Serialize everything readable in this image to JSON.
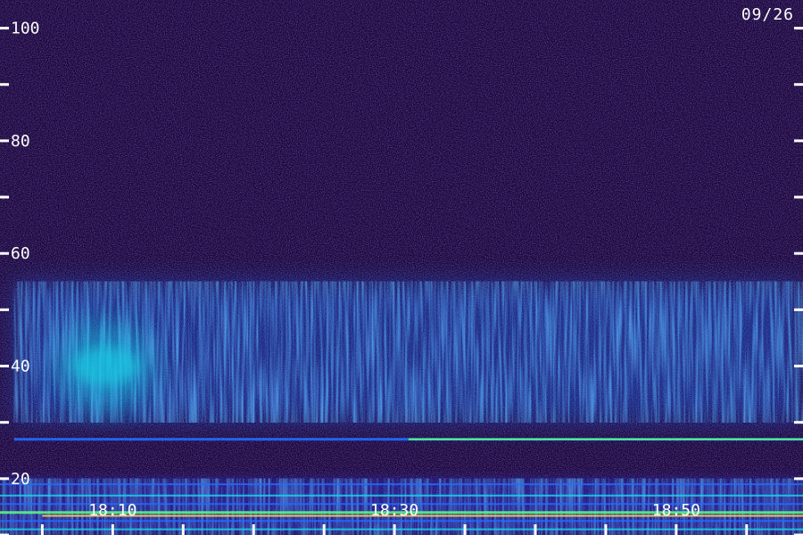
{
  "date_label": "09/26",
  "chart_data": {
    "type": "heatmap",
    "title": "",
    "xlabel": "",
    "ylabel": "",
    "ylim": [
      10,
      105
    ],
    "xlim": [
      "18:02",
      "18:59"
    ],
    "y_ticks_labeled": [
      20,
      40,
      60,
      80,
      100
    ],
    "y_ticks_minor": [
      10,
      30,
      50,
      70,
      90
    ],
    "x_tick_labels": [
      "18:10",
      "18:30",
      "18:50"
    ],
    "colormap": [
      "#1b0a3c",
      "#2a0f8c",
      "#2d2fd6",
      "#1f6dff",
      "#17d6e8",
      "#5cff7a",
      "#ffd24a"
    ],
    "features": [
      {
        "name": "broadband hiss band",
        "y_range": [
          30,
          55
        ],
        "x_range": [
          "18:03",
          "18:59"
        ],
        "intensity": "medium"
      },
      {
        "name": "hiss maximum",
        "y_range": [
          35,
          45
        ],
        "x_range": [
          "18:06",
          "18:13"
        ],
        "intensity": "high"
      },
      {
        "name": "narrowband line",
        "y": 27,
        "x_range": [
          "18:03",
          "18:59"
        ],
        "intensity": "high"
      },
      {
        "name": "low-frequency lines",
        "y_range": [
          10,
          20
        ],
        "x_range": [
          "18:02",
          "18:59"
        ],
        "intensity": "high"
      }
    ]
  }
}
